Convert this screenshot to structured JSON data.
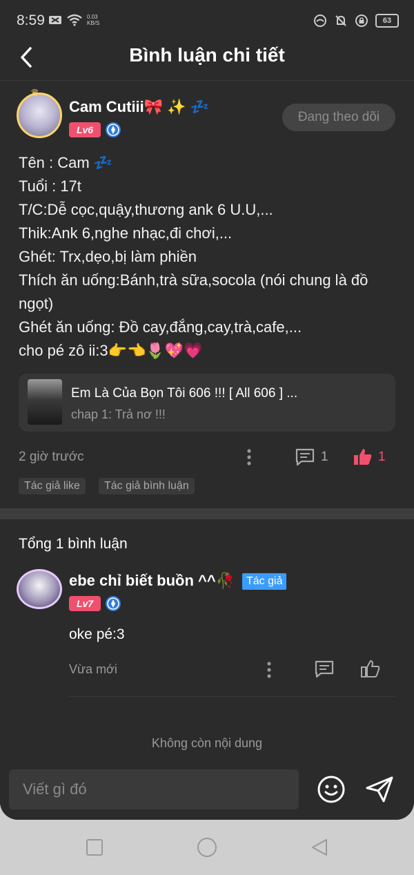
{
  "status": {
    "time": "8:59",
    "net_speed_value": "0.03",
    "net_speed_unit": "KB/S",
    "battery": "63"
  },
  "header": {
    "title": "Bình luận chi tiết"
  },
  "post": {
    "username": "Cam Cutiii🎀 ✨ 💤",
    "level": "Lv6",
    "follow_label": "Đang theo dõi",
    "lines": [
      "Tên : Cam 💤",
      "Tuổi : 17t",
      "T/C:Dễ cọc,quậy,thương ank 6 U.U,...",
      "Thik:Ank 6,nghe nhạc,đi chơi,...",
      "Ghét: Trx,dẹo,bị làm phiền",
      "Thích ăn uống:Bánh,trà sữa,socola (nói chung là đồ ngọt)",
      "Ghét ăn uống: Đồ cay,đắng,cay,trà,cafe,...",
      "cho pé zô ii:3👉👈🌷💖💗"
    ],
    "chapter": {
      "title": "Em Là Của Bọn Tôi 606 !!! [ All 606 ] ...",
      "subtitle": "chap 1: Trả nơ !!!"
    },
    "time": "2 giờ trước",
    "comment_count": "1",
    "like_count": "1",
    "tags": [
      "Tác giả like",
      "Tác giả bình luận"
    ]
  },
  "comments_section": {
    "total_label": "Tổng 1 bình luận",
    "comments": [
      {
        "username": "ebe chỉ biết buồn ^^🥀",
        "author_badge": "Tác giả",
        "level": "Lv7",
        "text": "oke pé:3",
        "time": "Vừa mới"
      }
    ],
    "end_label": "Không còn nội dung"
  },
  "composer": {
    "placeholder": "Viết gì đó"
  },
  "colors": {
    "background": "#2b2b2b",
    "accent_pink": "#f0506e",
    "author_blue": "#3b9cff"
  }
}
